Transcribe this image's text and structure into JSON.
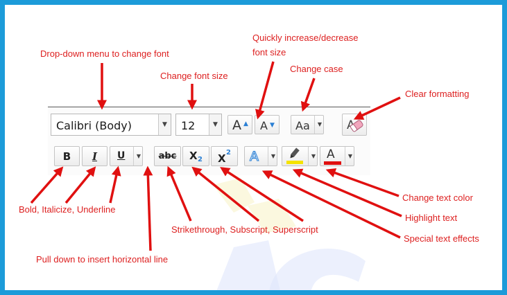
{
  "annotations": {
    "font_dropdown": "Drop-down menu to change font",
    "font_size": "Change font size",
    "grow_shrink_line1": "Quickly increase/decrease",
    "grow_shrink_line2": "font size",
    "change_case": "Change case",
    "clear_formatting": "Clear formatting",
    "bold_italic_underline": "Bold, Italicize, Underline",
    "strike_sub_super": "Strikethrough, Subscript, Superscript",
    "horizontal_line": "Pull down to insert horizontal line",
    "text_color": "Change text color",
    "highlight": "Highlight text",
    "text_effects": "Special text effects"
  },
  "toolbar": {
    "font_name": "Calibri (Body)",
    "font_size": "12",
    "grow_font": "A",
    "shrink_font": "A",
    "change_case": "Aa",
    "bold": "B",
    "italic": "I",
    "underline": "U",
    "strikethrough": "abc",
    "subscript_base": "X",
    "subscript_mark": "2",
    "superscript_base": "X",
    "superscript_mark": "2",
    "text_effects": "A",
    "font_color": "A"
  },
  "icons": {
    "dropdown_arrow": "▼",
    "grow_arrow": "▲",
    "shrink_arrow": "▼",
    "clear_formatting": "eraser-icon",
    "highlight": "highlighter-pen-icon"
  },
  "colors": {
    "frame": "#1c9bd9",
    "annotation": "#dd2020",
    "highlight": "#f5e300",
    "font_color": "#e01010",
    "accent_blue": "#2a7fd4"
  }
}
